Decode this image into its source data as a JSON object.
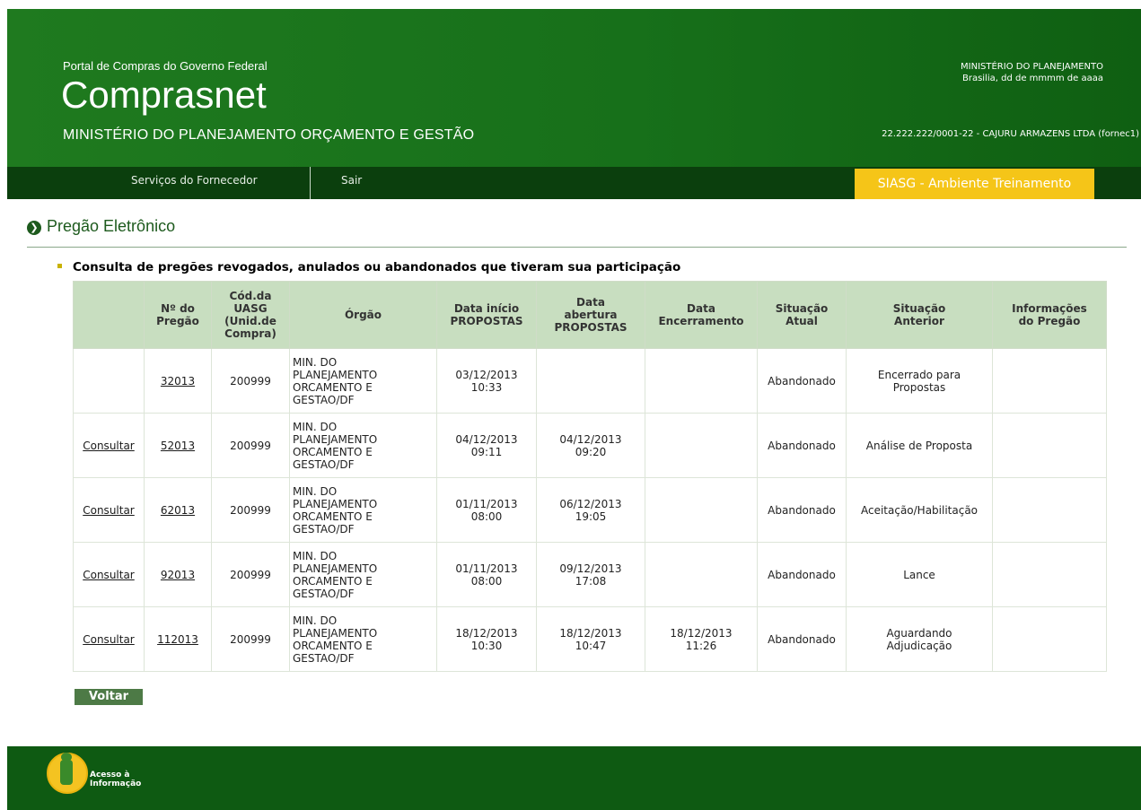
{
  "header": {
    "portal": "Portal de Compras do Governo Federal",
    "brand": "Comprasnet",
    "ministry": "MINISTÉRIO DO PLANEJAMENTO ORÇAMENTO E GESTÃO",
    "right_ministry": "MINISTÉRIO DO PLANEJAMENTO",
    "right_date": "Brasilia, dd de mmmm de aaaa",
    "user": "22.222.222/0001-22 - CAJURU ARMAZENS LTDA (fornec1)"
  },
  "nav": {
    "servicos": "Serviços do Fornecedor",
    "sair": "Sair",
    "ambiente": "SIASG - Ambiente Treinamento"
  },
  "page": {
    "title": "Pregão Eletrônico",
    "subtitle": "Consulta de pregões revogados, anulados ou abandonados que tiveram sua participação"
  },
  "table": {
    "headers": {
      "nro_line1": "Nº do",
      "nro_line2": "Pregão",
      "uasg_line1": "Cód.da",
      "uasg_line2": "UASG",
      "uasg_line3": "(Unid.de",
      "uasg_line4": "Compra)",
      "orgao": "Órgão",
      "inicio_line1": "Data início",
      "inicio_line2": "PROPOSTAS",
      "abertura_line1": "Data",
      "abertura_line2": "abertura",
      "abertura_line3": "PROPOSTAS",
      "encerramento_line1": "Data",
      "encerramento_line2": "Encerramento",
      "atual_line1": "Situação",
      "atual_line2": "Atual",
      "anterior_line1": "Situação",
      "anterior_line2": "Anterior",
      "info_line1": "Informações",
      "info_line2": "do Pregão"
    },
    "rows": [
      {
        "consultar": "",
        "pregao": "32013",
        "uasg": "200999",
        "org1": "MIN. DO",
        "org2": "PLANEJAMENTO",
        "org3": "ORCAMENTO E",
        "org4": "GESTAO/DF",
        "inicio_d": "03/12/2013",
        "inicio_h": "10:33",
        "abertura_d": "",
        "abertura_h": "",
        "enc_d": "",
        "enc_h": "",
        "atual": "Abandonado",
        "anterior1": "Encerrado para",
        "anterior2": "Propostas",
        "info": ""
      },
      {
        "consultar": "Consultar",
        "pregao": "52013",
        "uasg": "200999",
        "org1": "MIN. DO",
        "org2": "PLANEJAMENTO",
        "org3": "ORCAMENTO E",
        "org4": "GESTAO/DF",
        "inicio_d": "04/12/2013",
        "inicio_h": "09:11",
        "abertura_d": "04/12/2013",
        "abertura_h": "09:20",
        "enc_d": "",
        "enc_h": "",
        "atual": "Abandonado",
        "anterior1": "Análise de Proposta",
        "anterior2": "",
        "info": ""
      },
      {
        "consultar": "Consultar",
        "pregao": "62013",
        "uasg": "200999",
        "org1": "MIN. DO",
        "org2": "PLANEJAMENTO",
        "org3": "ORCAMENTO E",
        "org4": "GESTAO/DF",
        "inicio_d": "01/11/2013",
        "inicio_h": "08:00",
        "abertura_d": "06/12/2013",
        "abertura_h": "19:05",
        "enc_d": "",
        "enc_h": "",
        "atual": "Abandonado",
        "anterior1": "Aceitação/Habilitação",
        "anterior2": "",
        "info": ""
      },
      {
        "consultar": "Consultar",
        "pregao": "92013",
        "uasg": "200999",
        "org1": "MIN. DO",
        "org2": "PLANEJAMENTO",
        "org3": "ORCAMENTO E",
        "org4": "GESTAO/DF",
        "inicio_d": "01/11/2013",
        "inicio_h": "08:00",
        "abertura_d": "09/12/2013",
        "abertura_h": "17:08",
        "enc_d": "",
        "enc_h": "",
        "atual": "Abandonado",
        "anterior1": "Lance",
        "anterior2": "",
        "info": ""
      },
      {
        "consultar": "Consultar",
        "pregao": "112013",
        "uasg": "200999",
        "org1": "MIN. DO",
        "org2": "PLANEJAMENTO",
        "org3": "ORCAMENTO E",
        "org4": "GESTAO/DF",
        "inicio_d": "18/12/2013",
        "inicio_h": "10:30",
        "abertura_d": "18/12/2013",
        "abertura_h": "10:47",
        "enc_d": "18/12/2013",
        "enc_h": "11:26",
        "atual": "Abandonado",
        "anterior1": "Aguardando",
        "anterior2": "Adjudicação",
        "info": ""
      }
    ]
  },
  "buttons": {
    "voltar": "Voltar"
  },
  "footer": {
    "acesso_line1": "Acesso à",
    "acesso_line2": "Informação",
    "icon": "information-icon"
  },
  "colors": {
    "header_green": "#1f7a1f",
    "nav_dark": "#0b3f0d",
    "ambiente_yellow": "#f5c518",
    "table_header": "#c8dec0"
  }
}
